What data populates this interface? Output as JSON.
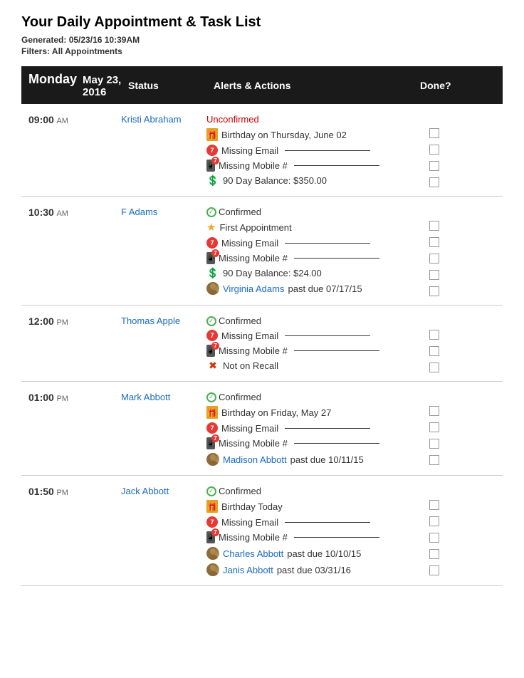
{
  "page": {
    "title": "Your Daily Appointment & Task List",
    "generated_label": "Generated:",
    "generated_value": "05/23/16 10:39AM",
    "filters_label": "Filters:",
    "filters_value": "All Appointments"
  },
  "table_header": {
    "day": "Monday",
    "date": "May 23, 2016",
    "status_col": "Status",
    "alerts_col": "Alerts & Actions",
    "done_col": "Done?"
  },
  "appointments": [
    {
      "id": "appt-1",
      "time": "09:00",
      "ampm": "AM",
      "name": "Kristi Abraham",
      "status": "Unconfirmed",
      "status_type": "unconfirmed",
      "alerts": [
        {
          "type": "birthday",
          "text": "Birthday on Thursday, June 02",
          "link": false
        },
        {
          "type": "email",
          "text": "Missing Email",
          "underline": true,
          "link": false
        },
        {
          "type": "mobile",
          "text": "Missing Mobile #",
          "underline": true,
          "link": false
        },
        {
          "type": "balance",
          "text": "90 Day Balance: $350.00",
          "link": false
        }
      ]
    },
    {
      "id": "appt-2",
      "time": "10:30",
      "ampm": "AM",
      "name": "F Adams",
      "status": "Confirmed",
      "status_type": "confirmed",
      "alerts": [
        {
          "type": "star",
          "text": "First Appointment",
          "link": false
        },
        {
          "type": "email",
          "text": "Missing Email",
          "underline": true,
          "link": false
        },
        {
          "type": "mobile",
          "text": "Missing Mobile #",
          "underline": true,
          "link": false
        },
        {
          "type": "balance",
          "text": "90 Day Balance: $24.00",
          "link": false
        },
        {
          "type": "pastdue",
          "text": " past due 07/17/15",
          "link_text": "Virginia Adams",
          "link": true
        }
      ]
    },
    {
      "id": "appt-3",
      "time": "12:00",
      "ampm": "PM",
      "name": "Thomas Apple",
      "status": "Confirmed",
      "status_type": "confirmed",
      "alerts": [
        {
          "type": "email",
          "text": "Missing Email",
          "underline": true,
          "link": false
        },
        {
          "type": "mobile",
          "text": "Missing Mobile #",
          "underline": true,
          "link": false
        },
        {
          "type": "recall",
          "text": "Not on Recall",
          "link": false
        }
      ]
    },
    {
      "id": "appt-4",
      "time": "01:00",
      "ampm": "PM",
      "name": "Mark Abbott",
      "status": "Confirmed",
      "status_type": "confirmed",
      "alerts": [
        {
          "type": "birthday",
          "text": "Birthday on Friday, May 27",
          "link": false
        },
        {
          "type": "email",
          "text": "Missing Email",
          "underline": true,
          "link": false
        },
        {
          "type": "mobile",
          "text": "Missing Mobile #",
          "underline": true,
          "link": false
        },
        {
          "type": "pastdue",
          "text": " past due 10/11/15",
          "link_text": "Madison Abbott",
          "link": true
        }
      ]
    },
    {
      "id": "appt-5",
      "time": "01:50",
      "ampm": "PM",
      "name": "Jack Abbott",
      "status": "Confirmed",
      "status_type": "confirmed",
      "alerts": [
        {
          "type": "birthday",
          "text": "Birthday Today",
          "link": false
        },
        {
          "type": "email",
          "text": "Missing Email",
          "underline": true,
          "link": false
        },
        {
          "type": "mobile",
          "text": "Missing Mobile #",
          "underline": true,
          "link": false
        },
        {
          "type": "pastdue",
          "text": " past due 10/10/15",
          "link_text": "Charles Abbott",
          "link": true
        },
        {
          "type": "pastdue",
          "text": " past due 03/31/16",
          "link_text": "Janis Abbott",
          "link": true
        }
      ]
    }
  ]
}
